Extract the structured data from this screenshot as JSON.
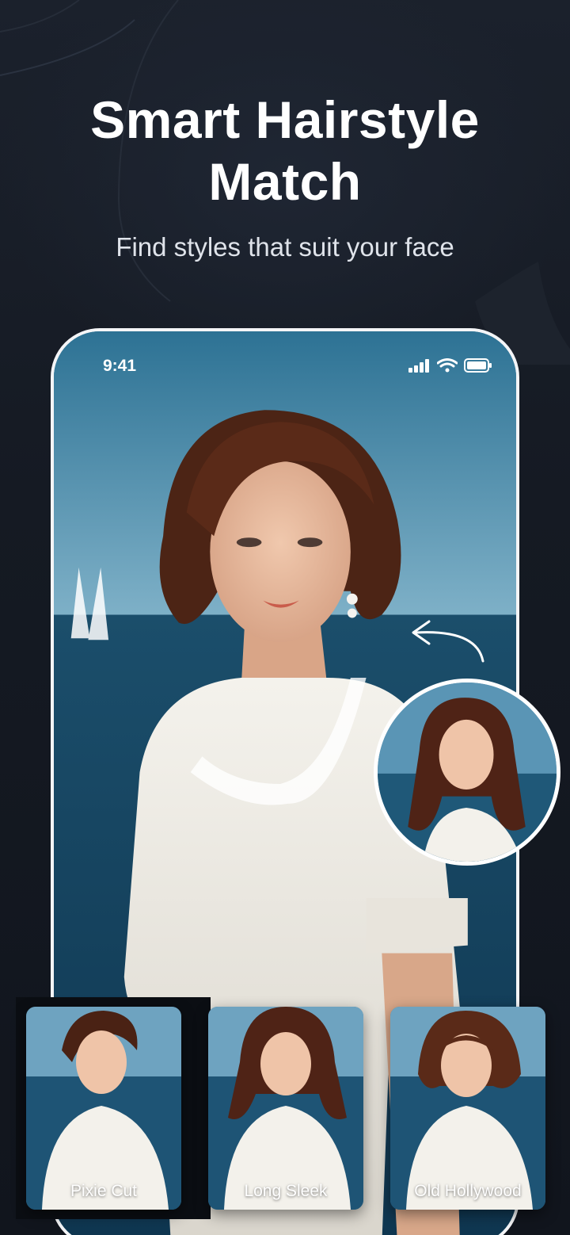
{
  "hero": {
    "title_line1": "Smart Hairstyle",
    "title_line2": "Match",
    "subtitle": "Find styles that suit your face"
  },
  "phone": {
    "status_time": "9:41",
    "status_icons": [
      "signal-icon",
      "wifi-icon",
      "battery-icon"
    ]
  },
  "preview": {
    "icon": "curved-arrow-icon"
  },
  "styles": [
    {
      "label": "Pixie Cut",
      "hair": "short-pixie"
    },
    {
      "label": "Long Sleek",
      "hair": "long-wavy"
    },
    {
      "label": "Old Hollywood",
      "hair": "bob-bangs"
    }
  ],
  "colors": {
    "background": "#151a23",
    "sky": "#4f8cae",
    "sea": "#1c4f6c",
    "hair": "#5a2a18",
    "dress": "#f1efe9",
    "text": "#ffffff"
  }
}
